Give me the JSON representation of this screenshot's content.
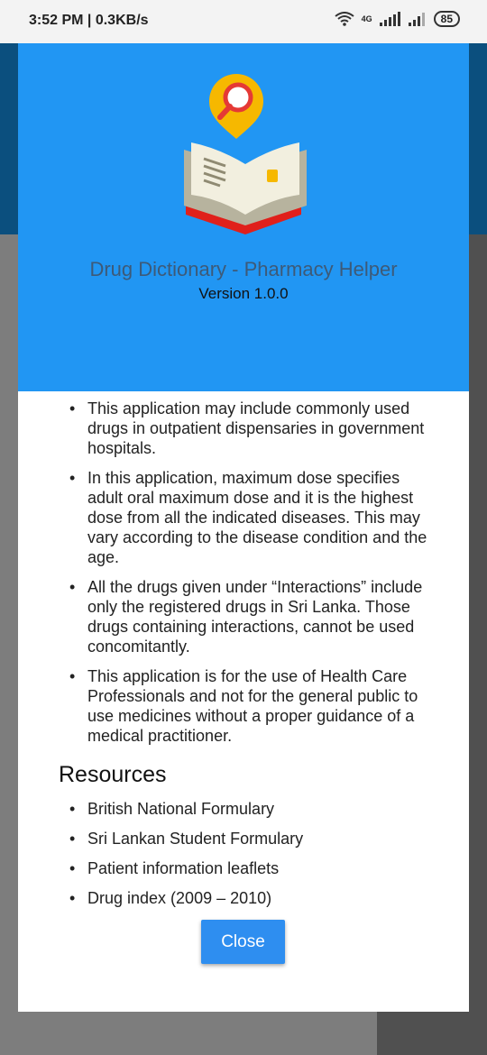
{
  "status_bar": {
    "time_speed": "3:52 PM | 0.3KB/s",
    "network": "4G",
    "battery": "85"
  },
  "dialog": {
    "app_title": "Drug Dictionary - Pharmacy Helper",
    "version": "Version 1.0.0",
    "info_items": [
      "This application may include commonly used drugs in outpatient dispensaries in government hospitals.",
      "In this application, maximum dose specifies adult oral maximum dose and it is the highest dose from all the indicated diseases. This may vary according to the disease condition and the age.",
      "All the drugs given under “Interactions” include only the registered drugs in Sri Lanka. Those drugs containing interactions, cannot be used concomitantly.",
      "This application is for the use of Health Care Professionals and not for the general public to use medicines without a proper guidance of a medical practitioner."
    ],
    "resources_title": "Resources",
    "resources": [
      "British National Formulary",
      "Sri Lankan Student Formulary",
      "Patient information leaflets",
      "Drug index (2009 – 2010)"
    ],
    "close_label": "Close"
  },
  "colors": {
    "header_blue": "#2196f3",
    "button_blue": "#2e8ef0",
    "title_color": "#3d5a78"
  }
}
